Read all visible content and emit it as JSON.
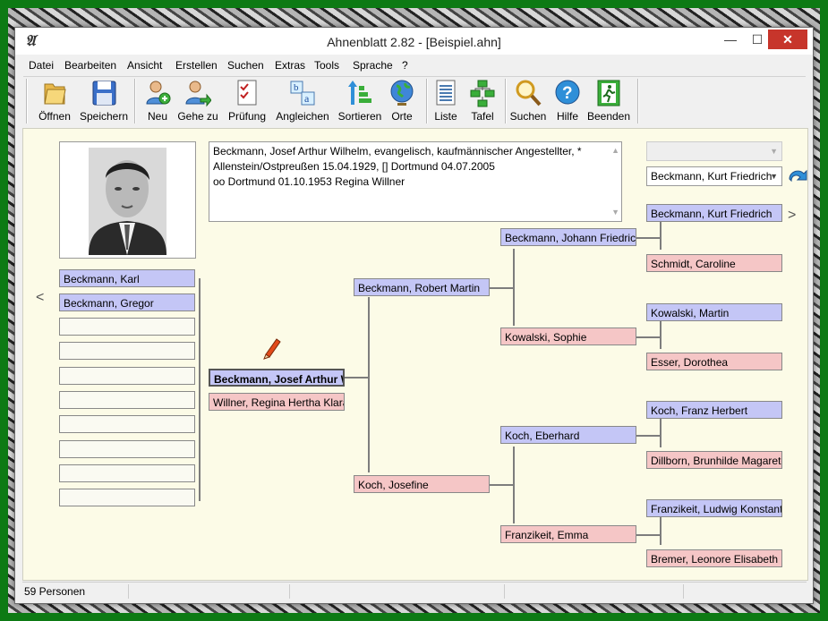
{
  "window": {
    "title": "Ahnenblatt 2.82 - [Beispiel.ahn]",
    "min_glyph": "—",
    "max_glyph": "☐",
    "close_glyph": "✕"
  },
  "menu": [
    "Datei",
    "Bearbeiten",
    "Ansicht",
    "Erstellen",
    "Suchen",
    "Extras",
    "Tools",
    "Sprache",
    "?"
  ],
  "toolbar": {
    "open": "Öffnen",
    "save": "Speichern",
    "new": "Neu",
    "goto": "Gehe zu",
    "check": "Prüfung",
    "align": "Angleichen",
    "sort": "Sortieren",
    "places": "Orte",
    "list": "Liste",
    "board": "Tafel",
    "search": "Suchen",
    "help": "Hilfe",
    "quit": "Beenden"
  },
  "info": {
    "line1": "Beckmann, Josef Arthur Wilhelm, evangelisch, kaufmännischer Angestellter, *",
    "line2": "Allenstein/Ostpreußen 15.04.1929, [] Dortmund 04.07.2005",
    "line3": "oo Dortmund 01.10.1953 Regina Willner"
  },
  "children": [
    "Beckmann, Karl",
    "Beckmann, Gregor",
    "",
    "",
    "",
    "",
    "",
    "",
    "",
    ""
  ],
  "nav": {
    "left": "<",
    "right": ">"
  },
  "proband": {
    "name": "Beckmann, Josef Arthur Wilhelm",
    "spouse": "Willner, Regina Hertha Klara"
  },
  "parents": {
    "father": "Beckmann, Robert Martin",
    "mother": "Koch, Josefine"
  },
  "grandparents": {
    "ff": "Beckmann, Johann Friedrich",
    "fm": "Kowalski, Sophie",
    "mf": "Koch, Eberhard",
    "mm": "Franzikeit, Emma"
  },
  "greatgrandparents": {
    "fff": "Beckmann, Kurt Friedrich",
    "ffm": "Schmidt, Caroline",
    "fmf": "Kowalski, Martin",
    "fmm": "Esser, Dorothea",
    "mff": "Koch, Franz Herbert",
    "mfm": "Dillborn, Brunhilde Magarete",
    "mmf": "Franzikeit, Ludwig Konstantin",
    "mmm": "Bremer, Leonore Elisabeth"
  },
  "combo": {
    "top": "",
    "selected": "Beckmann, Kurt Friedrich"
  },
  "status": {
    "persons": "59 Personen"
  },
  "colors": {
    "male": "#c4c6f6",
    "female": "#f5c6c6",
    "background": "#fcfbe7",
    "border_green": "#0d7a14"
  }
}
